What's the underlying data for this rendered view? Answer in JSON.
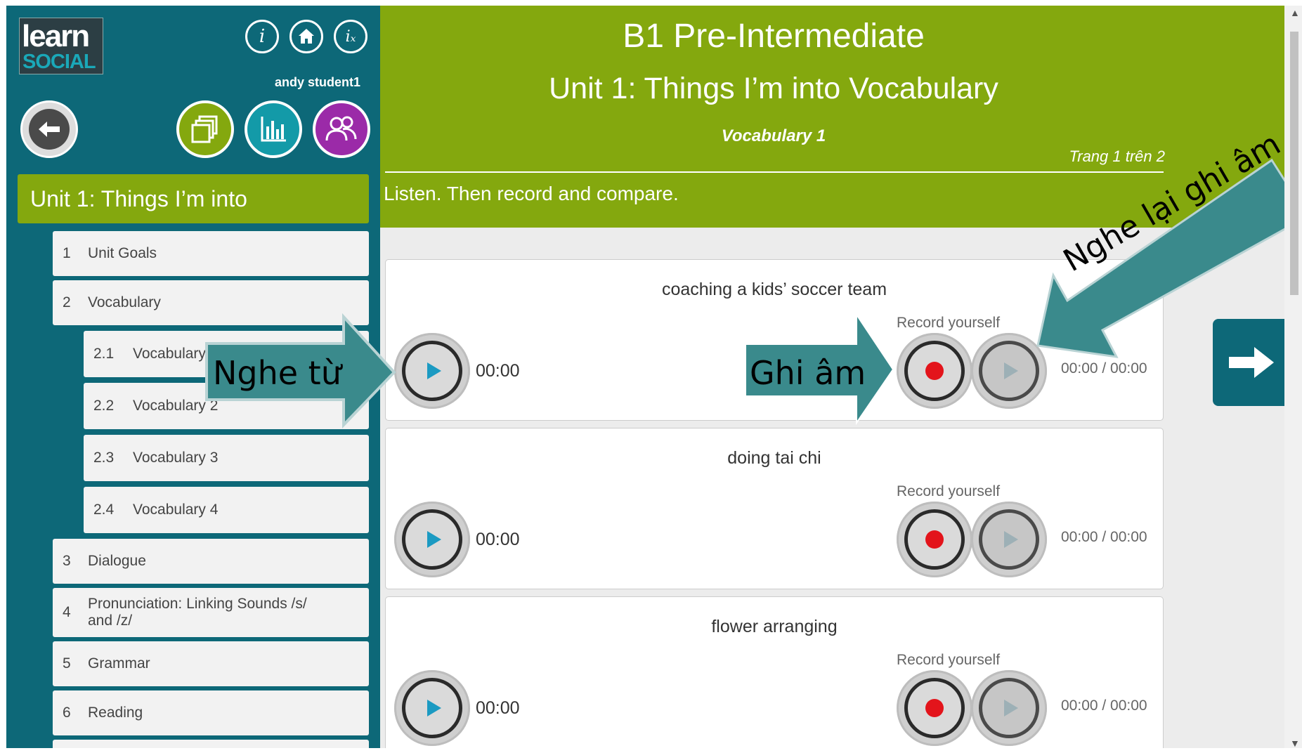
{
  "logo": {
    "line1": "learn",
    "line2": "SOCIAL"
  },
  "top_icons": [
    {
      "name": "info-icon",
      "glyph": "i"
    },
    {
      "name": "home-icon",
      "glyph": "⌂"
    },
    {
      "name": "info-extra-icon",
      "glyph": "iₓ"
    }
  ],
  "user": {
    "name": "andy student1"
  },
  "sidebar": {
    "unit_title": "Unit 1: Things I’m into",
    "items": [
      {
        "num": "1",
        "label": "Unit Goals"
      },
      {
        "num": "2",
        "label": "Vocabulary"
      },
      {
        "num": "2.1",
        "label": "Vocabulary 1"
      },
      {
        "num": "2.2",
        "label": "Vocabulary 2"
      },
      {
        "num": "2.3",
        "label": "Vocabulary 3"
      },
      {
        "num": "2.4",
        "label": "Vocabulary 4"
      },
      {
        "num": "3",
        "label": "Dialogue"
      },
      {
        "num": "4",
        "label": "Pronunciation: Linking Sounds /s/ and /z/"
      },
      {
        "num": "5",
        "label": "Grammar"
      },
      {
        "num": "6",
        "label": "Reading"
      }
    ]
  },
  "header": {
    "course": "B1 Pre-Intermediate",
    "unit": "Unit 1: Things I’m into Vocabulary",
    "section": "Vocabulary 1",
    "page": "Trang 1 trên 2",
    "instructions": "Listen. Then record and compare."
  },
  "cards": [
    {
      "word": "coaching a kids’ soccer team",
      "time": "00:00",
      "record_label": "Record yourself",
      "record_time": "00:00 / 00:00"
    },
    {
      "word": "doing tai chi",
      "time": "00:00",
      "record_label": "Record yourself",
      "record_time": "00:00 / 00:00"
    },
    {
      "word": "flower arranging",
      "time": "00:00",
      "record_label": "Record yourself",
      "record_time": "00:00 / 00:00"
    }
  ],
  "annotations": {
    "listen_word": "Nghe từ",
    "record": "Ghi âm",
    "replay_recording": "Nghe lại ghi âm"
  },
  "colors": {
    "sidebar": "#0d6878",
    "accent_green": "#84a80e",
    "callout": "#3a8a8c",
    "record_red": "#e3141b",
    "play_blue": "#1b9ac2"
  }
}
